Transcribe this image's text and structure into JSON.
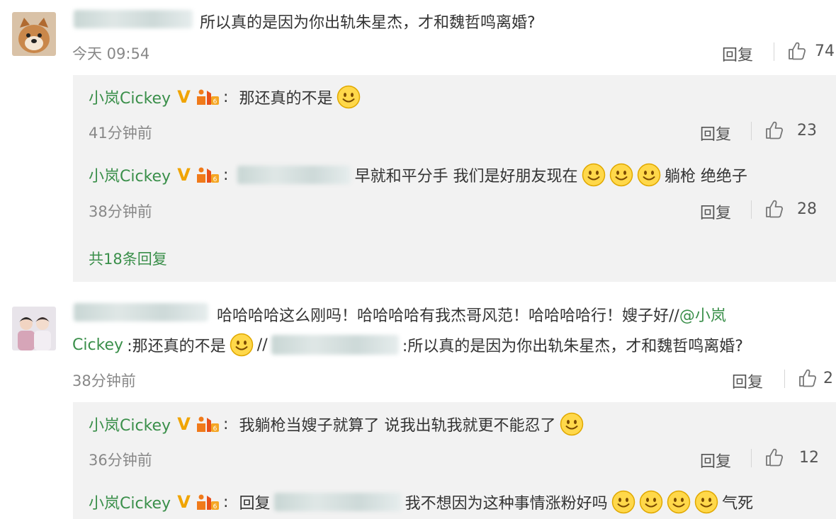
{
  "comment1": {
    "text": "所以真的是因为你出轨朱星杰，才和魏哲鸣离婚?",
    "time": "今天 09:54",
    "reply_label": "回复",
    "likes": "74",
    "replies": [
      {
        "user": "小岚Cickey",
        "colon": ":",
        "text": "那还真的不是",
        "time": "41分钟前",
        "reply_label": "回复",
        "likes": "23"
      },
      {
        "user": "小岚Cickey",
        "colon": ":",
        "text_after_blur": "早就和平分手 我们是好朋友现在",
        "text_end": "躺枪 绝绝子",
        "time": "38分钟前",
        "reply_label": "回复",
        "likes": "28"
      }
    ],
    "more_replies": "共18条回复"
  },
  "comment2": {
    "line1_text": "哈哈哈哈这么刚吗！哈哈哈哈有我杰哥风范！哈哈哈哈行！嫂子好//",
    "line1_mention": "@小岚",
    "line2_mention": "Cickey",
    "line2_text_a": ":那还真的不是",
    "line2_text_b": "//",
    "line2_text_c": ":所以真的是因为你出轨朱星杰，才和魏哲鸣离婚?",
    "time": "38分钟前",
    "reply_label": "回复",
    "likes": "2",
    "replies": [
      {
        "user": "小岚Cickey",
        "colon": ":",
        "text": "我躺枪当嫂子就算了 说我出轨我就更不能忍了",
        "time": "36分钟前",
        "reply_label": "回复",
        "likes": "12"
      },
      {
        "user": "小岚Cickey",
        "colon": ":",
        "text_before_blur": "回复",
        "text_after_blur": "我不想因为这种事情涨粉好吗",
        "text_end": "气死"
      }
    ]
  },
  "colors": {
    "username_green": "#3a8f4a",
    "v_badge": "#f0a400",
    "panel_bg": "#f2f2f2"
  },
  "icons": [
    "thumbs-up-icon",
    "smiley-emoji",
    "verified-v-icon",
    "level-badge-icon",
    "avatar"
  ]
}
